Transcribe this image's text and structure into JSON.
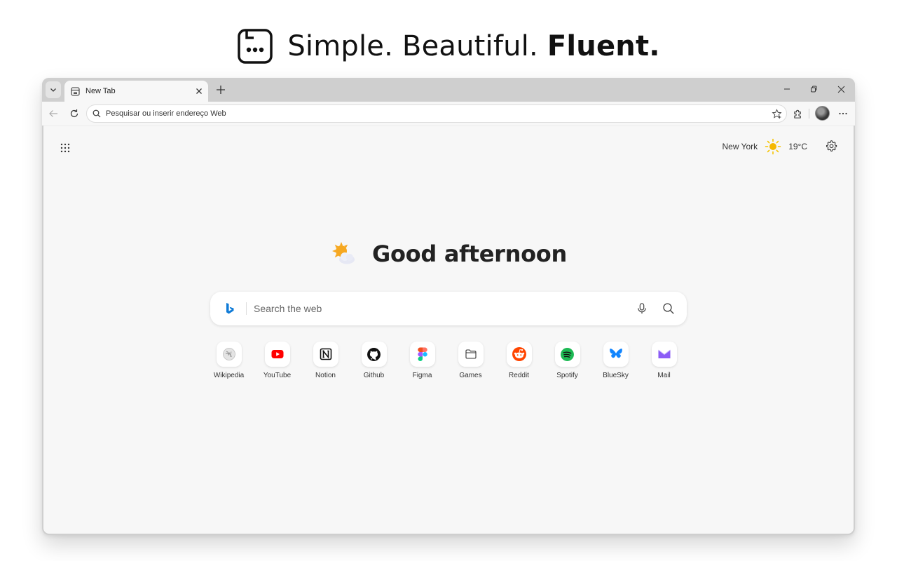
{
  "hero": {
    "tagline": "Simple. Beautiful.",
    "tagline_bold": "Fluent."
  },
  "browser": {
    "tab_title": "New Tab",
    "address_placeholder": "Pesquisar ou inserir endereço Web"
  },
  "newtab": {
    "weather": {
      "city": "New York",
      "temperature": "19°C"
    },
    "greeting": "Good afternoon",
    "search_placeholder": "Search the web",
    "shortcuts": [
      {
        "label": "Wikipedia",
        "icon": "wikipedia-icon"
      },
      {
        "label": "YouTube",
        "icon": "youtube-icon",
        "color": "#ff0000"
      },
      {
        "label": "Notion",
        "icon": "notion-icon"
      },
      {
        "label": "Github",
        "icon": "github-icon"
      },
      {
        "label": "Figma",
        "icon": "figma-icon"
      },
      {
        "label": "Games",
        "icon": "folder-icon"
      },
      {
        "label": "Reddit",
        "icon": "reddit-icon",
        "color": "#ff4500"
      },
      {
        "label": "Spotify",
        "icon": "spotify-icon",
        "color": "#1db954"
      },
      {
        "label": "BlueSky",
        "icon": "bluesky-icon",
        "color": "#1185fe"
      },
      {
        "label": "Mail",
        "icon": "mail-icon",
        "color": "#8b5cf6"
      }
    ]
  },
  "colors": {
    "bing_blue": "#0f7bd7",
    "sun_yellow": "#f5b800"
  }
}
